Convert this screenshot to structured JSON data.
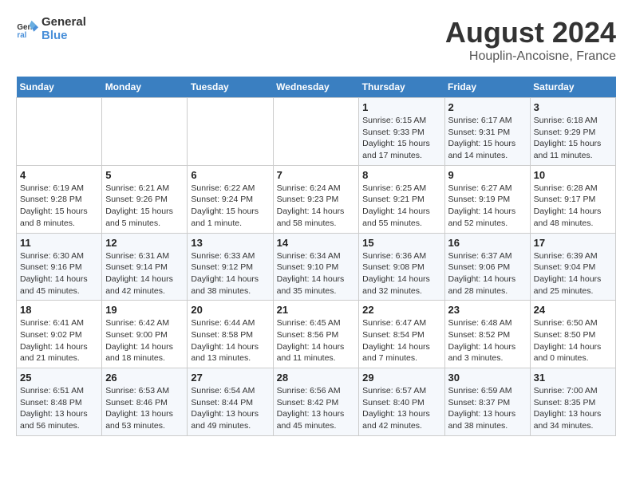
{
  "logo": {
    "line1": "General",
    "line2": "Blue"
  },
  "title": "August 2024",
  "subtitle": "Houplin-Ancoisne, France",
  "days_of_week": [
    "Sunday",
    "Monday",
    "Tuesday",
    "Wednesday",
    "Thursday",
    "Friday",
    "Saturday"
  ],
  "weeks": [
    [
      {
        "day": "",
        "info": ""
      },
      {
        "day": "",
        "info": ""
      },
      {
        "day": "",
        "info": ""
      },
      {
        "day": "",
        "info": ""
      },
      {
        "day": "1",
        "info": "Sunrise: 6:15 AM\nSunset: 9:33 PM\nDaylight: 15 hours\nand 17 minutes."
      },
      {
        "day": "2",
        "info": "Sunrise: 6:17 AM\nSunset: 9:31 PM\nDaylight: 15 hours\nand 14 minutes."
      },
      {
        "day": "3",
        "info": "Sunrise: 6:18 AM\nSunset: 9:29 PM\nDaylight: 15 hours\nand 11 minutes."
      }
    ],
    [
      {
        "day": "4",
        "info": "Sunrise: 6:19 AM\nSunset: 9:28 PM\nDaylight: 15 hours\nand 8 minutes."
      },
      {
        "day": "5",
        "info": "Sunrise: 6:21 AM\nSunset: 9:26 PM\nDaylight: 15 hours\nand 5 minutes."
      },
      {
        "day": "6",
        "info": "Sunrise: 6:22 AM\nSunset: 9:24 PM\nDaylight: 15 hours\nand 1 minute."
      },
      {
        "day": "7",
        "info": "Sunrise: 6:24 AM\nSunset: 9:23 PM\nDaylight: 14 hours\nand 58 minutes."
      },
      {
        "day": "8",
        "info": "Sunrise: 6:25 AM\nSunset: 9:21 PM\nDaylight: 14 hours\nand 55 minutes."
      },
      {
        "day": "9",
        "info": "Sunrise: 6:27 AM\nSunset: 9:19 PM\nDaylight: 14 hours\nand 52 minutes."
      },
      {
        "day": "10",
        "info": "Sunrise: 6:28 AM\nSunset: 9:17 PM\nDaylight: 14 hours\nand 48 minutes."
      }
    ],
    [
      {
        "day": "11",
        "info": "Sunrise: 6:30 AM\nSunset: 9:16 PM\nDaylight: 14 hours\nand 45 minutes."
      },
      {
        "day": "12",
        "info": "Sunrise: 6:31 AM\nSunset: 9:14 PM\nDaylight: 14 hours\nand 42 minutes."
      },
      {
        "day": "13",
        "info": "Sunrise: 6:33 AM\nSunset: 9:12 PM\nDaylight: 14 hours\nand 38 minutes."
      },
      {
        "day": "14",
        "info": "Sunrise: 6:34 AM\nSunset: 9:10 PM\nDaylight: 14 hours\nand 35 minutes."
      },
      {
        "day": "15",
        "info": "Sunrise: 6:36 AM\nSunset: 9:08 PM\nDaylight: 14 hours\nand 32 minutes."
      },
      {
        "day": "16",
        "info": "Sunrise: 6:37 AM\nSunset: 9:06 PM\nDaylight: 14 hours\nand 28 minutes."
      },
      {
        "day": "17",
        "info": "Sunrise: 6:39 AM\nSunset: 9:04 PM\nDaylight: 14 hours\nand 25 minutes."
      }
    ],
    [
      {
        "day": "18",
        "info": "Sunrise: 6:41 AM\nSunset: 9:02 PM\nDaylight: 14 hours\nand 21 minutes."
      },
      {
        "day": "19",
        "info": "Sunrise: 6:42 AM\nSunset: 9:00 PM\nDaylight: 14 hours\nand 18 minutes."
      },
      {
        "day": "20",
        "info": "Sunrise: 6:44 AM\nSunset: 8:58 PM\nDaylight: 14 hours\nand 13 minutes."
      },
      {
        "day": "21",
        "info": "Sunrise: 6:45 AM\nSunset: 8:56 PM\nDaylight: 14 hours\nand 11 minutes."
      },
      {
        "day": "22",
        "info": "Sunrise: 6:47 AM\nSunset: 8:54 PM\nDaylight: 14 hours\nand 7 minutes."
      },
      {
        "day": "23",
        "info": "Sunrise: 6:48 AM\nSunset: 8:52 PM\nDaylight: 14 hours\nand 3 minutes."
      },
      {
        "day": "24",
        "info": "Sunrise: 6:50 AM\nSunset: 8:50 PM\nDaylight: 14 hours\nand 0 minutes."
      }
    ],
    [
      {
        "day": "25",
        "info": "Sunrise: 6:51 AM\nSunset: 8:48 PM\nDaylight: 13 hours\nand 56 minutes."
      },
      {
        "day": "26",
        "info": "Sunrise: 6:53 AM\nSunset: 8:46 PM\nDaylight: 13 hours\nand 53 minutes."
      },
      {
        "day": "27",
        "info": "Sunrise: 6:54 AM\nSunset: 8:44 PM\nDaylight: 13 hours\nand 49 minutes."
      },
      {
        "day": "28",
        "info": "Sunrise: 6:56 AM\nSunset: 8:42 PM\nDaylight: 13 hours\nand 45 minutes."
      },
      {
        "day": "29",
        "info": "Sunrise: 6:57 AM\nSunset: 8:40 PM\nDaylight: 13 hours\nand 42 minutes."
      },
      {
        "day": "30",
        "info": "Sunrise: 6:59 AM\nSunset: 8:37 PM\nDaylight: 13 hours\nand 38 minutes."
      },
      {
        "day": "31",
        "info": "Sunrise: 7:00 AM\nSunset: 8:35 PM\nDaylight: 13 hours\nand 34 minutes."
      }
    ]
  ]
}
